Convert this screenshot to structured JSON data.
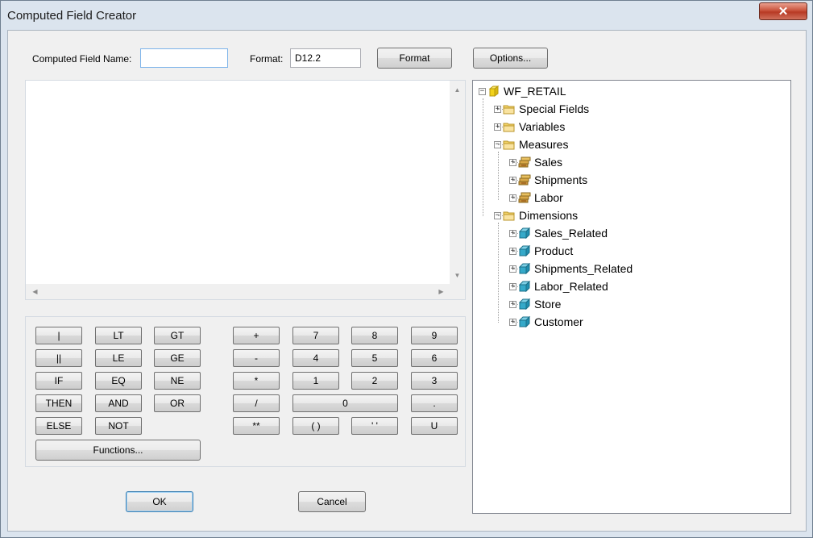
{
  "window": {
    "title": "Computed Field Creator",
    "close_glyph": "✕"
  },
  "form": {
    "name_label": "Computed Field Name:",
    "name_value": "",
    "format_label": "Format:",
    "format_value": "D12.2",
    "format_button": "Format",
    "options_button": "Options..."
  },
  "editor": {
    "text": "",
    "scroll_up": "▲",
    "scroll_down": "▼",
    "scroll_left": "◀",
    "scroll_right": "▶"
  },
  "keypad": {
    "operators": [
      "|",
      "LT",
      "GT",
      "||",
      "LE",
      "GE",
      "IF",
      "EQ",
      "NE",
      "THEN",
      "AND",
      "OR",
      "ELSE",
      "NOT"
    ],
    "functions_button": "Functions...",
    "numeric": [
      "+",
      "7",
      "8",
      "9",
      "-",
      "4",
      "5",
      "6",
      "*",
      "1",
      "2",
      "3",
      "/",
      "0",
      ".",
      "**",
      "( )",
      "' '",
      "U"
    ]
  },
  "footer": {
    "ok_button": "OK",
    "cancel_button": "Cancel"
  },
  "tree": {
    "root": "WF_RETAIL",
    "groups": [
      "Special Fields",
      "Variables",
      "Measures",
      "Dimensions"
    ],
    "measures": [
      "Sales",
      "Shipments",
      "Labor"
    ],
    "dimensions": [
      "Sales_Related",
      "Product",
      "Shipments_Related",
      "Labor_Related",
      "Store",
      "Customer"
    ]
  },
  "colors": {
    "folder": "#f3d46a",
    "root_cube": "#f2d21a",
    "measure": "#c8a040",
    "dimension": "#35a9c9"
  }
}
